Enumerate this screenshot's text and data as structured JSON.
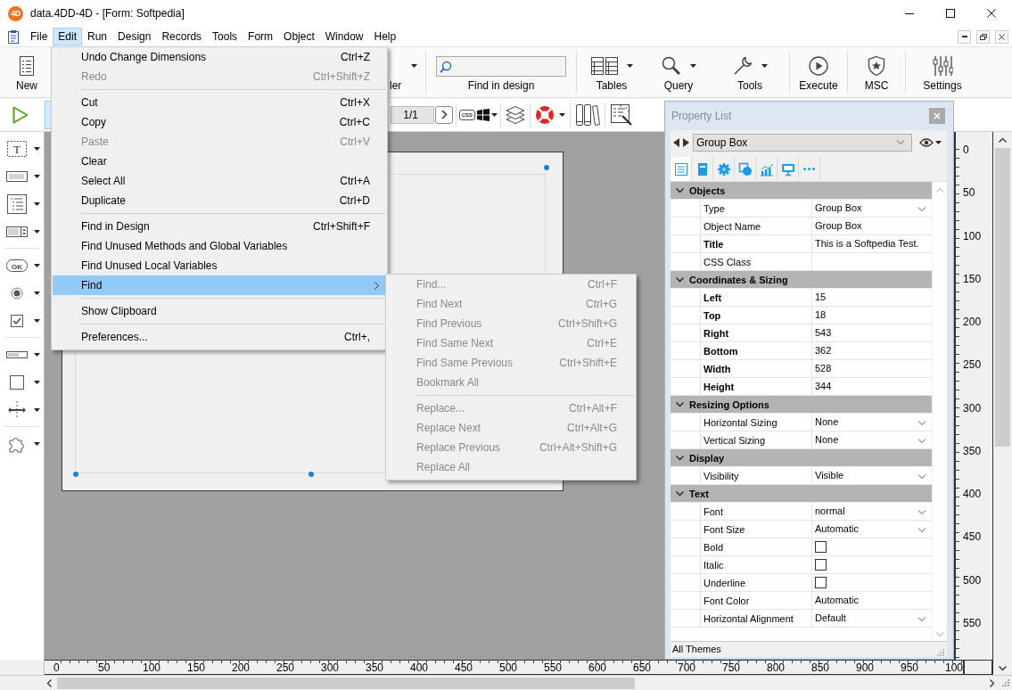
{
  "window": {
    "icon_text": "4D",
    "title": "data.4DD-4D - [Form: Softpedia]"
  },
  "menu_bar": [
    {
      "label": "File",
      "selected": false
    },
    {
      "label": "Edit",
      "selected": true
    },
    {
      "label": "Run",
      "selected": false
    },
    {
      "label": "Design",
      "selected": false
    },
    {
      "label": "Records",
      "selected": false
    },
    {
      "label": "Tools",
      "selected": false
    },
    {
      "label": "Form",
      "selected": false
    },
    {
      "label": "Object",
      "selected": false
    },
    {
      "label": "Window",
      "selected": false
    },
    {
      "label": "Help",
      "selected": false
    }
  ],
  "toolbar": [
    {
      "kind": "button",
      "label": "New",
      "dropdown": false
    },
    {
      "kind": "button",
      "label": "ler",
      "dropdown": true
    },
    {
      "kind": "search",
      "label": "Find in design"
    },
    {
      "kind": "button",
      "label": "Tables",
      "dropdown": true
    },
    {
      "kind": "button",
      "label": "Query",
      "dropdown": true
    },
    {
      "kind": "button",
      "label": "Tools",
      "dropdown": true
    },
    {
      "kind": "button",
      "label": "Execute",
      "dropdown": false
    },
    {
      "kind": "button",
      "label": "MSC",
      "dropdown": false
    },
    {
      "kind": "button",
      "label": "Settings",
      "dropdown": false
    }
  ],
  "form_toolbar": {
    "page_indicator": "1/1",
    "css_label": "css"
  },
  "tool_palette": {
    "text_tool_glyph": "T",
    "button_tool_label": "OK"
  },
  "edit_menu": [
    {
      "kind": "item",
      "label": "Undo Change Dimensions",
      "shortcut": "Ctrl+Z",
      "disabled": false,
      "selected": false,
      "submenu": false
    },
    {
      "kind": "item",
      "label": "Redo",
      "shortcut": "Ctrl+Shift+Z",
      "disabled": true,
      "selected": false,
      "submenu": false
    },
    {
      "kind": "separator"
    },
    {
      "kind": "item",
      "label": "Cut",
      "shortcut": "Ctrl+X",
      "disabled": false,
      "selected": false,
      "submenu": false
    },
    {
      "kind": "item",
      "label": "Copy",
      "shortcut": "Ctrl+C",
      "disabled": false,
      "selected": false,
      "submenu": false
    },
    {
      "kind": "item",
      "label": "Paste",
      "shortcut": "Ctrl+V",
      "disabled": true,
      "selected": false,
      "submenu": false
    },
    {
      "kind": "item",
      "label": "Clear",
      "disabled": false,
      "selected": false,
      "submenu": false
    },
    {
      "kind": "item",
      "label": "Select All",
      "shortcut": "Ctrl+A",
      "disabled": false,
      "selected": false,
      "submenu": false
    },
    {
      "kind": "item",
      "label": "Duplicate",
      "shortcut": "Ctrl+D",
      "disabled": false,
      "selected": false,
      "submenu": false
    },
    {
      "kind": "separator"
    },
    {
      "kind": "item",
      "label": "Find in Design",
      "shortcut": "Ctrl+Shift+F",
      "disabled": false,
      "selected": false,
      "submenu": false
    },
    {
      "kind": "item",
      "label": "Find Unused Methods and Global Variables",
      "disabled": false,
      "selected": false,
      "submenu": false
    },
    {
      "kind": "item",
      "label": "Find Unused Local Variables",
      "disabled": false,
      "selected": false,
      "submenu": false
    },
    {
      "kind": "item",
      "label": "Find",
      "disabled": false,
      "selected": true,
      "submenu": true
    },
    {
      "kind": "separator"
    },
    {
      "kind": "item",
      "label": "Show Clipboard",
      "disabled": false,
      "selected": false,
      "submenu": false
    },
    {
      "kind": "separator"
    },
    {
      "kind": "item",
      "label": "Preferences...",
      "shortcut": "Ctrl+,",
      "disabled": false,
      "selected": false,
      "submenu": false
    }
  ],
  "find_submenu": [
    {
      "kind": "item",
      "label": "Find...",
      "shortcut": "Ctrl+F",
      "disabled": true,
      "selected": false,
      "submenu": false
    },
    {
      "kind": "item",
      "label": "Find Next",
      "shortcut": "Ctrl+G",
      "disabled": true,
      "selected": false,
      "submenu": false
    },
    {
      "kind": "item",
      "label": "Find Previous",
      "shortcut": "Ctrl+Shift+G",
      "disabled": true,
      "selected": false,
      "submenu": false
    },
    {
      "kind": "item",
      "label": "Find Same Next",
      "shortcut": "Ctrl+E",
      "disabled": true,
      "selected": false,
      "submenu": false
    },
    {
      "kind": "item",
      "label": "Find Same Previous",
      "shortcut": "Ctrl+Shift+E",
      "disabled": true,
      "selected": false,
      "submenu": false
    },
    {
      "kind": "item",
      "label": "Bookmark All",
      "disabled": true,
      "selected": false,
      "submenu": false
    },
    {
      "kind": "separator"
    },
    {
      "kind": "item",
      "label": "Replace...",
      "shortcut": "Ctrl+Alt+F",
      "disabled": true,
      "selected": false,
      "submenu": false
    },
    {
      "kind": "item",
      "label": "Replace Next",
      "shortcut": "Ctrl+Alt+G",
      "disabled": true,
      "selected": false,
      "submenu": false
    },
    {
      "kind": "item",
      "label": "Replace Previous",
      "shortcut": "Ctrl+Alt+Shift+G",
      "disabled": true,
      "selected": false,
      "submenu": false
    },
    {
      "kind": "item",
      "label": "Replace All",
      "disabled": true,
      "selected": false,
      "submenu": false
    }
  ],
  "property_list": {
    "title": "Property List",
    "object": "Group Box",
    "tabs": [
      {
        "selected": true
      },
      {
        "selected": false
      },
      {
        "selected": false
      },
      {
        "selected": false
      },
      {
        "selected": false
      },
      {
        "selected": false
      },
      {
        "selected": false
      }
    ],
    "sections": [
      {
        "title": "Objects",
        "expanded": true,
        "rows": [
          {
            "kind": "dropdown",
            "label": "Type",
            "bold": false,
            "value": "Group Box"
          },
          {
            "kind": "text",
            "label": "Object Name",
            "bold": false,
            "value": "Group Box"
          },
          {
            "kind": "text",
            "label": "Title",
            "bold": true,
            "value": "This is a Softpedia Test."
          },
          {
            "kind": "text",
            "label": "CSS Class",
            "bold": false
          }
        ]
      },
      {
        "title": "Coordinates & Sizing",
        "expanded": true,
        "rows": [
          {
            "kind": "text",
            "label": "Left",
            "bold": true,
            "value": "15"
          },
          {
            "kind": "text",
            "label": "Top",
            "bold": true,
            "value": "18"
          },
          {
            "kind": "text",
            "label": "Right",
            "bold": true,
            "value": "543"
          },
          {
            "kind": "text",
            "label": "Bottom",
            "bold": true,
            "value": "362"
          },
          {
            "kind": "text",
            "label": "Width",
            "bold": true,
            "value": "528"
          },
          {
            "kind": "text",
            "label": "Height",
            "bold": true,
            "value": "344"
          }
        ]
      },
      {
        "title": "Resizing Options",
        "expanded": true,
        "rows": [
          {
            "kind": "dropdown",
            "label": "Horizontal Sizing",
            "bold": false,
            "value": "None"
          },
          {
            "kind": "dropdown",
            "label": "Vertical Sizing",
            "bold": false,
            "value": "None"
          }
        ]
      },
      {
        "title": "Display",
        "expanded": true,
        "rows": [
          {
            "kind": "dropdown",
            "label": "Visibility",
            "bold": false,
            "value": "Visible"
          }
        ]
      },
      {
        "title": "Text",
        "expanded": true,
        "rows": [
          {
            "kind": "dropdown",
            "label": "Font",
            "bold": false,
            "value": "normal"
          },
          {
            "kind": "dropdown",
            "label": "Font Size",
            "bold": false,
            "value": "Automatic"
          },
          {
            "kind": "checkbox",
            "label": "Bold",
            "bold": false,
            "checked": false
          },
          {
            "kind": "checkbox",
            "label": "Italic",
            "bold": false,
            "checked": false
          },
          {
            "kind": "checkbox",
            "label": "Underline",
            "bold": false,
            "checked": false
          },
          {
            "kind": "text",
            "label": "Font Color",
            "bold": false,
            "value": "Automatic"
          },
          {
            "kind": "dropdown",
            "label": "Horizontal Alignment",
            "bold": false,
            "value": "Default"
          }
        ]
      }
    ],
    "footer": "All Themes"
  },
  "vertical_ruler": [
    "0",
    "50",
    "100",
    "150",
    "200",
    "250",
    "300",
    "350",
    "400",
    "450",
    "500",
    "550"
  ],
  "horizontal_ruler": [
    "0",
    "50",
    "100",
    "150",
    "200",
    "250",
    "300",
    "350",
    "400",
    "450",
    "500",
    "550",
    "600",
    "650",
    "700",
    "750",
    "800",
    "850",
    "900",
    "950",
    "100"
  ]
}
